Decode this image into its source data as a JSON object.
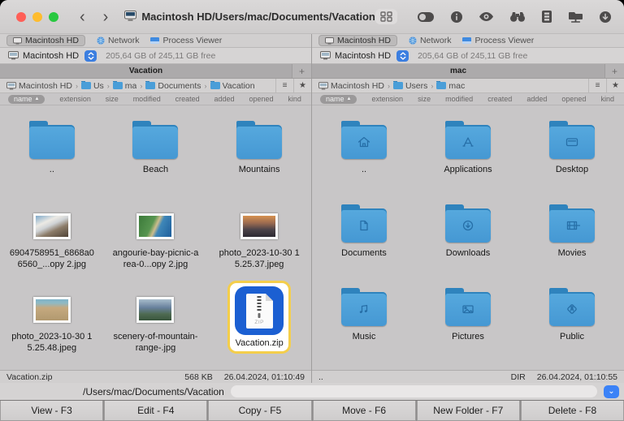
{
  "titlebar": {
    "title": "Macintosh HD/Users/mac/Documents/Vacation"
  },
  "icons": {
    "back": "‹",
    "forward": "›",
    "add_tab": "+",
    "menu_lines": "≡",
    "star": "★",
    "sort_arrow": "▲",
    "chevron_down": "⌄"
  },
  "panes": [
    {
      "device_tabs": [
        {
          "label": "Macintosh HD",
          "active": true
        },
        {
          "label": "Network",
          "active": false
        },
        {
          "label": "Process Viewer",
          "active": false
        }
      ],
      "drive": {
        "name": "Macintosh HD",
        "free": "205,64 GB of 245,11 GB free"
      },
      "tab_title": "Vacation",
      "breadcrumb": [
        "Macintosh HD",
        "Us",
        "ma",
        "Documents",
        "Vacation"
      ],
      "columns": [
        "name",
        "extension",
        "size",
        "modified",
        "created",
        "added",
        "opened",
        "kind"
      ],
      "files": [
        {
          "label": "..",
          "type": "folder"
        },
        {
          "label": "Beach",
          "type": "folder"
        },
        {
          "label": "Mountains",
          "type": "folder"
        },
        {
          "label": "6904758951_6868a06560_...opy 2.jpg",
          "type": "image",
          "thumb": "mountains"
        },
        {
          "label": "angourie-bay-picnic-area-0...opy 2.jpg",
          "type": "image",
          "thumb": "bay"
        },
        {
          "label": "photo_2023-10-30 15.25.37.jpeg",
          "type": "image",
          "thumb": "sunset"
        },
        {
          "label": "photo_2023-10-30 15.25.48.jpeg",
          "type": "image",
          "thumb": "sand"
        },
        {
          "label": "scenery-of-mountain-range-.jpg",
          "type": "image",
          "thumb": "range"
        },
        {
          "label": "Vacation.zip",
          "type": "zip-archive",
          "selected": true
        }
      ],
      "status": {
        "name": "Vacation.zip",
        "size": "568 KB",
        "date": "26.04.2024, 01:10:49"
      }
    },
    {
      "device_tabs": [
        {
          "label": "Macintosh HD",
          "active": true
        },
        {
          "label": "Network",
          "active": false
        },
        {
          "label": "Process Viewer",
          "active": false
        }
      ],
      "drive": {
        "name": "Macintosh HD",
        "free": "205,64 GB of 245,11 GB free"
      },
      "tab_title": "mac",
      "breadcrumb": [
        "Macintosh HD",
        "Users",
        "mac"
      ],
      "columns": [
        "name",
        "extension",
        "size",
        "modified",
        "created",
        "added",
        "opened",
        "kind"
      ],
      "files": [
        {
          "label": "..",
          "type": "folder",
          "glyph": "home"
        },
        {
          "label": "Applications",
          "type": "folder",
          "glyph": "applications"
        },
        {
          "label": "Desktop",
          "type": "folder",
          "glyph": "desktop"
        },
        {
          "label": "Documents",
          "type": "folder",
          "glyph": "documents"
        },
        {
          "label": "Downloads",
          "type": "folder",
          "glyph": "downloads"
        },
        {
          "label": "Movies",
          "type": "folder",
          "glyph": "movies"
        },
        {
          "label": "Music",
          "type": "folder",
          "glyph": "music"
        },
        {
          "label": "Pictures",
          "type": "folder",
          "glyph": "pictures"
        },
        {
          "label": "Public",
          "type": "folder",
          "glyph": "public"
        }
      ],
      "status": {
        "name": "..",
        "size": "DIR",
        "date": "26.04.2024, 01:10:55"
      }
    }
  ],
  "commandline": {
    "path": "/Users/mac/Documents/Vacation",
    "input_value": ""
  },
  "function_buttons": [
    "View - F3",
    "Edit - F4",
    "Copy - F5",
    "Move - F6",
    "New Folder - F7",
    "Delete - F8"
  ],
  "colors": {
    "selection_blue": "#1b5fd2",
    "selection_border_yellow": "#f4ce4b",
    "folder_blue": "#4d9fd6",
    "accent_blue": "#3b82f7"
  }
}
